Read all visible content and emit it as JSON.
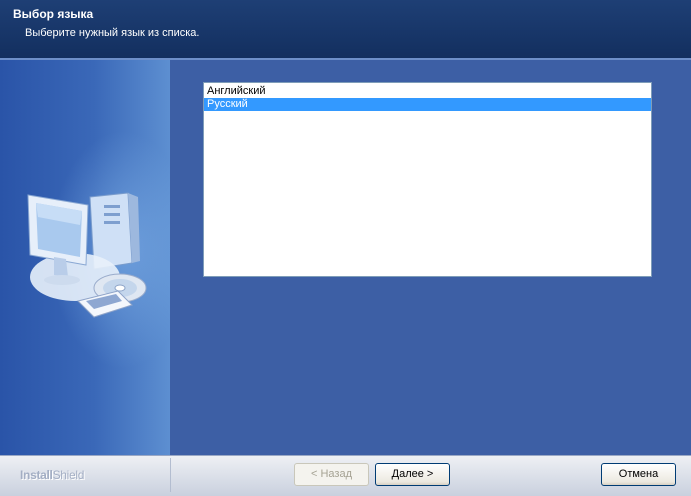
{
  "header": {
    "title": "Выбор языка",
    "subtitle": "Выберите нужный язык из списка."
  },
  "language_list": {
    "items": [
      {
        "label": "Английский",
        "selected": false
      },
      {
        "label": "Русский",
        "selected": true
      }
    ]
  },
  "footer": {
    "brand_part1": "Install",
    "brand_part2": "Shield",
    "back_label": "< Назад",
    "next_label": "Далее >",
    "cancel_label": "Отмена"
  },
  "colors": {
    "header_bg": "#132f5f",
    "panel_bg": "#3d5fa5",
    "selection": "#3399ff"
  }
}
